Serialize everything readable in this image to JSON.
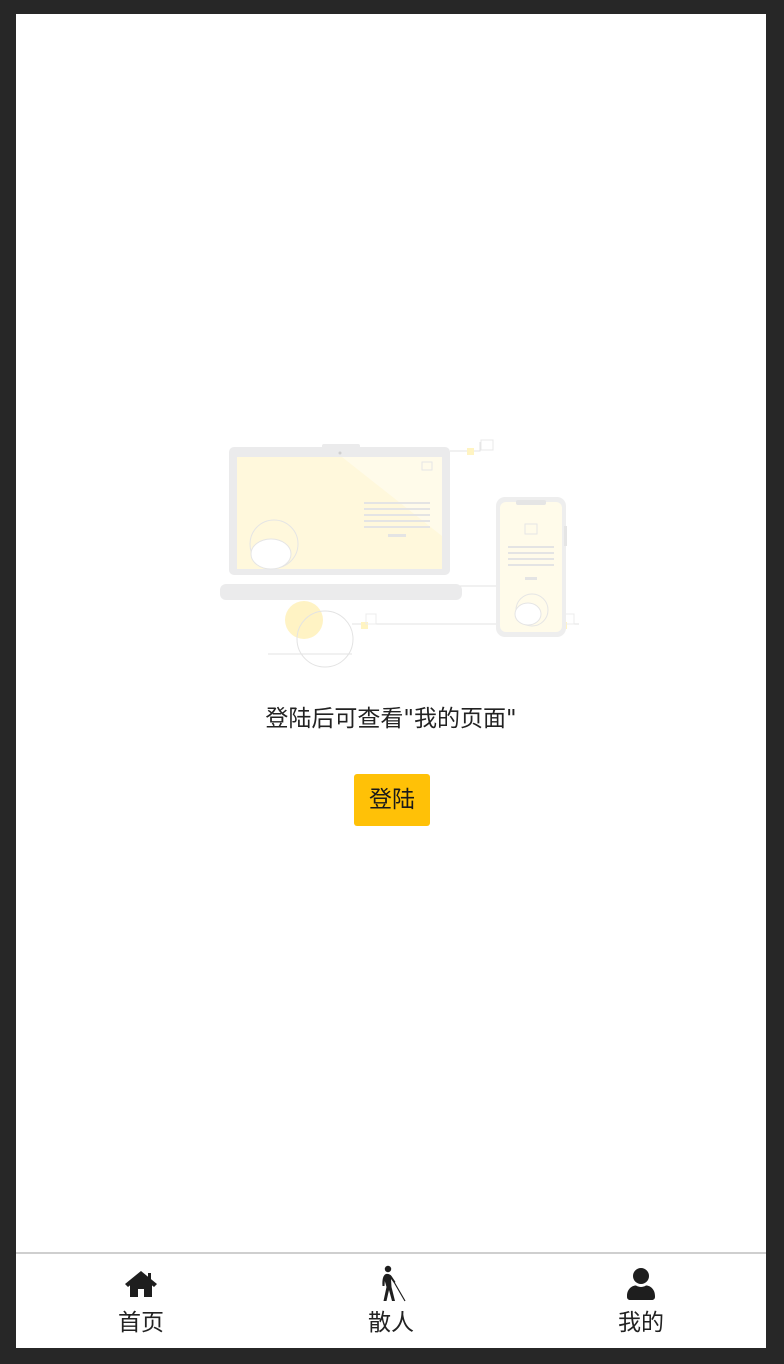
{
  "empty_state": {
    "illustration": "laptop-and-phone-illustration",
    "message": "登陆后可查看\"我的页面\"",
    "login_label": "登陆"
  },
  "tabbar": {
    "items": [
      {
        "label": "首页",
        "icon": "home-icon"
      },
      {
        "label": "散人",
        "icon": "blind-walker-icon"
      },
      {
        "label": "我的",
        "icon": "user-icon"
      }
    ]
  },
  "colors": {
    "accent": "#ffc107",
    "background": "#ffffff",
    "frame": "#272727",
    "text": "#222222"
  }
}
